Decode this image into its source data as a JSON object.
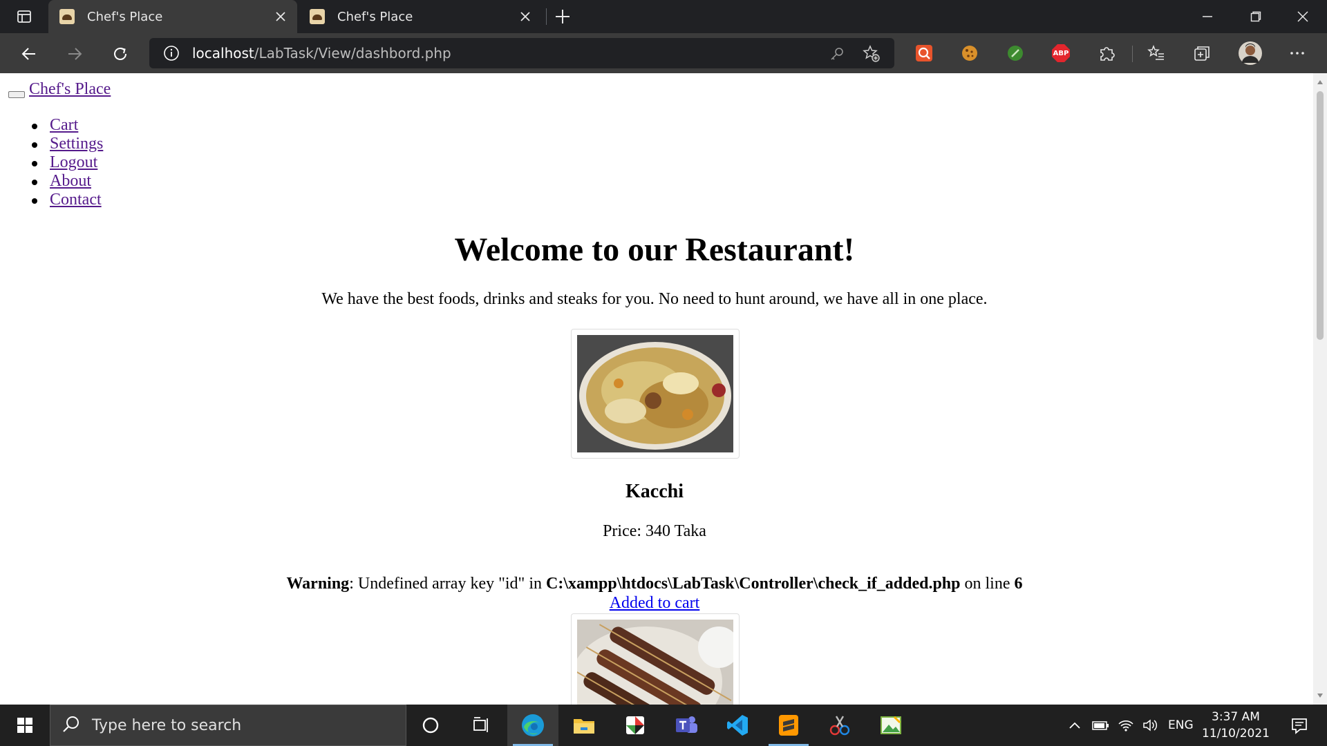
{
  "browser": {
    "tabs": [
      {
        "title": "Chef's Place",
        "active": true
      },
      {
        "title": "Chef's Place",
        "active": false
      }
    ],
    "url_host": "localhost",
    "url_path": "/LabTask/View/dashbord.php",
    "extensions": [
      "spotlight-extension-icon",
      "cookie-extension-icon",
      "leaf-extension-icon",
      "adblock-plus-icon",
      "puzzle-extensions-icon"
    ],
    "adblock_label": "ABP"
  },
  "page": {
    "brand": "Chef's Place",
    "nav": [
      {
        "label": "Cart"
      },
      {
        "label": "Settings"
      },
      {
        "label": "Logout"
      },
      {
        "label": "About"
      },
      {
        "label": "Contact"
      }
    ],
    "heading": "Welcome to our Restaurant!",
    "tagline": "We have the best foods, drinks and steaks for you. No need to hunt around, we have all in one place.",
    "items": [
      {
        "name": "Kacchi",
        "price": "Price: 340 Taka"
      }
    ],
    "warning": {
      "label": "Warning",
      "message": ": Undefined array key \"id\" in ",
      "file": "C:\\xampp\\htdocs\\LabTask\\Controller\\check_if_added.php",
      "line_text": " on line ",
      "line": "6"
    },
    "added_link": "Added to cart"
  },
  "taskbar": {
    "search_placeholder": "Type here to search",
    "language": "ENG",
    "time": "3:37 AM",
    "date": "11/10/2021"
  },
  "colors": {
    "chrome_dark": "#202124",
    "toolbar": "#3b3b3b",
    "visited_link": "#551a8b",
    "link": "#0000ee",
    "taskbar": "#202020"
  }
}
